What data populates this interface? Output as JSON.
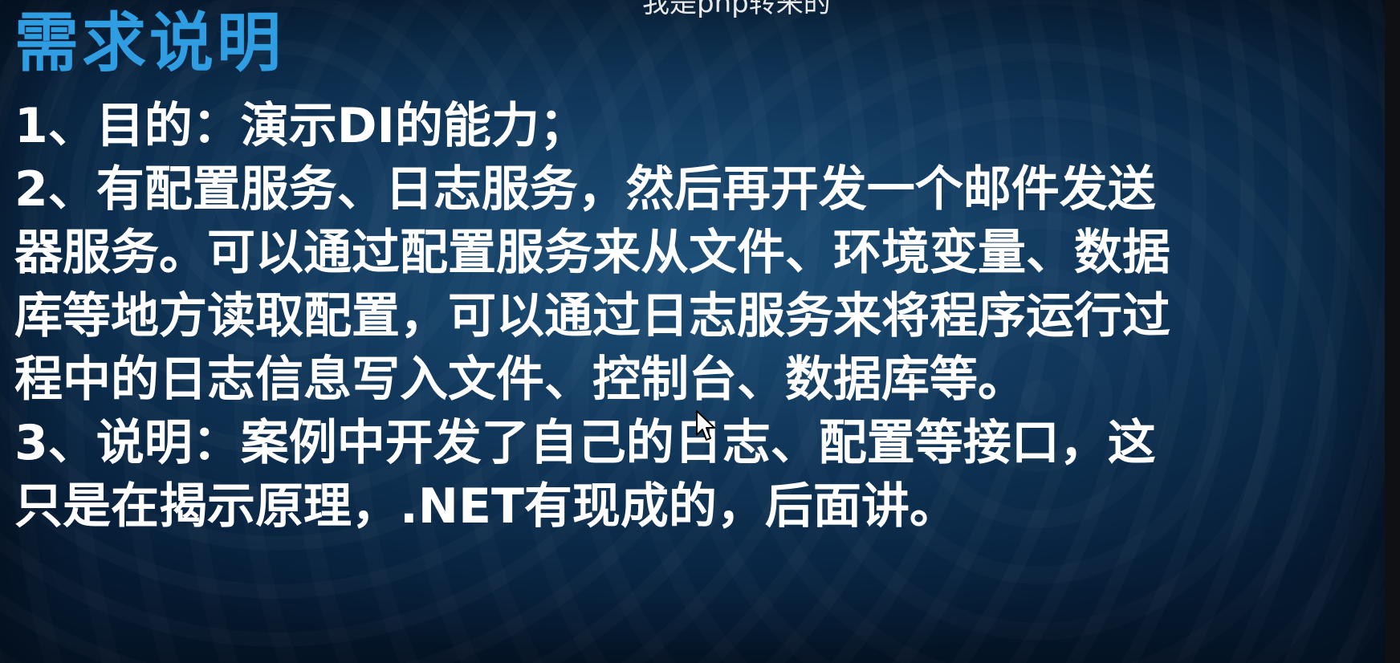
{
  "caption": "我是php转来的",
  "slide": {
    "title": "需求说明",
    "lines": [
      "1、目的：演示DI的能力；",
      "2、有配置服务、日志服务，然后再开发一个邮件发送",
      "器服务。可以通过配置服务来从文件、环境变量、数据",
      "库等地方读取配置，可以通过日志服务来将程序运行过",
      "程中的日志信息写入文件、控制台、数据库等。",
      "3、说明：案例中开发了自己的日志、配置等接口，这",
      "只是在揭示原理，.NET有现成的，后面讲。"
    ]
  },
  "colors": {
    "title": "#2f9de2",
    "body_text": "#ffffff",
    "background": "#123a5e"
  },
  "icons": {
    "cursor": "mouse-pointer-icon"
  }
}
